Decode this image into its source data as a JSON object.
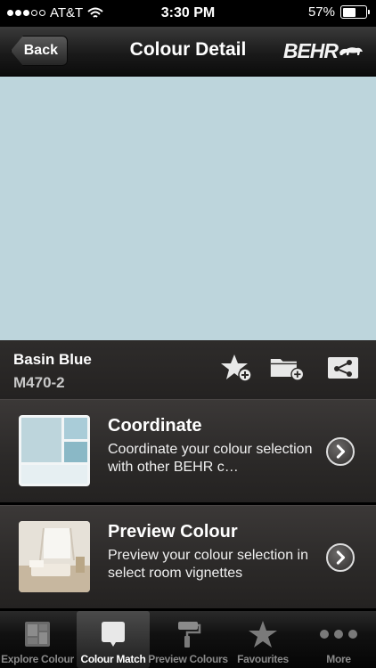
{
  "status_bar": {
    "carrier": "AT&T",
    "time": "3:30 PM",
    "battery_text": "57%",
    "battery_level": 0.57
  },
  "nav": {
    "back_label": "Back",
    "title": "Colour Detail",
    "brand": "BEHR"
  },
  "swatch": {
    "color": "#bdd5dc"
  },
  "colour": {
    "name": "Basin Blue",
    "code": "M470-2"
  },
  "actions": [
    {
      "icon": "add-favourite-star-icon"
    },
    {
      "icon": "add-to-folder-icon"
    },
    {
      "icon": "share-icon"
    }
  ],
  "rows": [
    {
      "title": "Coordinate",
      "description": "Coordinate your colour selection with other BEHR c…",
      "icon": "coordinate-palette-thumbnail"
    },
    {
      "title": "Preview Colour",
      "description": "Preview your colour selection in select room vignettes",
      "icon": "room-vignette-thumbnail"
    }
  ],
  "tabs": [
    {
      "label": "Explore Colour",
      "icon": "explore-colour-icon",
      "active": false
    },
    {
      "label": "Colour Match",
      "icon": "colour-match-icon",
      "active": true
    },
    {
      "label": "Preview Colours",
      "icon": "paint-roller-icon",
      "active": false
    },
    {
      "label": "Favourites",
      "icon": "star-icon",
      "active": false
    },
    {
      "label": "More",
      "icon": "more-dots-icon",
      "active": false
    }
  ],
  "colors": {
    "accent_swatch": "#bdd5dc",
    "coordinate_dark": "#8ab8c6",
    "coordinate_light": "#e6eff2"
  }
}
